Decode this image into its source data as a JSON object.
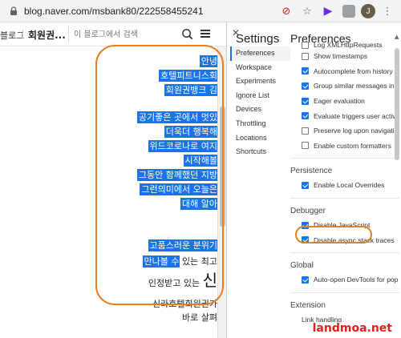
{
  "browser": {
    "url": "blog.naver.com/msbank80/222558455241",
    "profile_initial": "J"
  },
  "blog_header": {
    "left_link": "블로그",
    "title": "회원권...",
    "search_placeholder": "이 블로그에서 검색"
  },
  "blog_content": {
    "selected_lines": [
      "안녕",
      "호텔피트니스회",
      "회원권뱅크 김",
      "공기좋은 곳에서 멋있",
      "더욱더 행복해",
      "위드코로나로 여지",
      "시작해볼",
      "그동안 함께했던 지방",
      "그런의미에서 오늘은",
      "대해 알아",
      "고품스러운 분위기",
      "만나볼 수"
    ],
    "line11_tail": " 있는 최고",
    "line12": "인정받고 있는",
    "line12_big": "신",
    "line13": "신라호텔회원권가",
    "line14": "바로 살펴"
  },
  "devtools": {
    "close": "✕",
    "settings_title": "Settings",
    "nav": [
      "Preferences",
      "Workspace",
      "Experiments",
      "Ignore List",
      "Devices",
      "Throttling",
      "Locations",
      "Shortcuts"
    ],
    "pane_title": "Preferences",
    "options": [
      {
        "label": "Log XMLHttpRequests",
        "checked": false
      },
      {
        "label": "Show timestamps",
        "checked": false
      },
      {
        "label": "Autocomplete from history",
        "checked": true
      },
      {
        "label": "Group similar messages in c",
        "checked": true
      },
      {
        "label": "Eager evaluation",
        "checked": true
      },
      {
        "label": "Evaluate triggers user activa",
        "checked": true
      },
      {
        "label": "Preserve log upon navigatio",
        "checked": false
      },
      {
        "label": "Enable custom formatters",
        "checked": false
      }
    ],
    "persistence": {
      "title": "Persistence",
      "options": [
        {
          "label": "Enable Local Overrides",
          "checked": true
        }
      ]
    },
    "debugger": {
      "title": "Debugger",
      "options": [
        {
          "label": "Disable JavaScript",
          "checked": true
        },
        {
          "label": "Disable async stack traces",
          "checked": true
        }
      ]
    },
    "global": {
      "title": "Global",
      "options": [
        {
          "label": "Auto-open DevTools for pop",
          "checked": true
        }
      ]
    },
    "extension": {
      "title": "Extension",
      "link_label": "Link handling"
    }
  },
  "watermark": "landmoa.net",
  "colors": {
    "accent": "#1a73e8",
    "annotation": "#e67e22",
    "watermark": "#e02020"
  }
}
